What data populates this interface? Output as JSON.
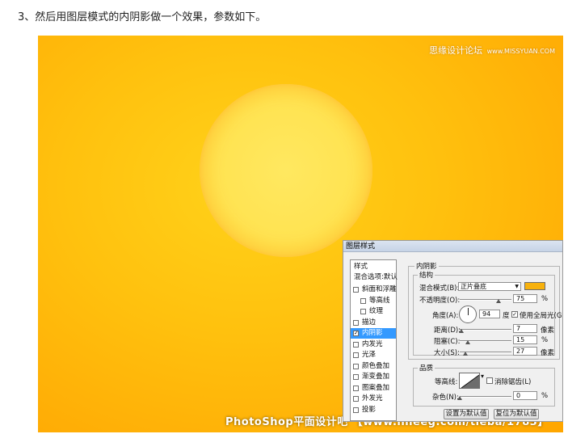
{
  "caption": "3、然后用图层模式的内阴影做一个效果，参数如下。",
  "watermarks": {
    "site_name": "思缘设计论坛",
    "site_url": "www.MISSYUAN.COM",
    "bottom_text": "PhotoShop平面设计吧 【www.lineeg.com/tieba/1783】"
  },
  "colors": {
    "canvas_center": "#ffd21a",
    "canvas_edge": "#ffa600",
    "sun": "#ffe352",
    "shadow_color": "#f7b10c",
    "selection": "#3399ff"
  },
  "dialog": {
    "title": "图层样式",
    "styles_header": "样式",
    "blend_default": "混合选项:默认",
    "items": [
      {
        "label": "斜面和浮雕",
        "checked": false,
        "indent": false,
        "selected": false
      },
      {
        "label": "等高线",
        "checked": false,
        "indent": true,
        "selected": false
      },
      {
        "label": "纹理",
        "checked": false,
        "indent": true,
        "selected": false
      },
      {
        "label": "描边",
        "checked": false,
        "indent": false,
        "selected": false
      },
      {
        "label": "内阴影",
        "checked": true,
        "indent": false,
        "selected": true
      },
      {
        "label": "内发光",
        "checked": false,
        "indent": false,
        "selected": false
      },
      {
        "label": "光泽",
        "checked": false,
        "indent": false,
        "selected": false
      },
      {
        "label": "颜色叠加",
        "checked": false,
        "indent": false,
        "selected": false
      },
      {
        "label": "渐变叠加",
        "checked": false,
        "indent": false,
        "selected": false
      },
      {
        "label": "图案叠加",
        "checked": false,
        "indent": false,
        "selected": false
      },
      {
        "label": "外发光",
        "checked": false,
        "indent": false,
        "selected": false
      },
      {
        "label": "投影",
        "checked": false,
        "indent": false,
        "selected": false
      }
    ],
    "inner_shadow": {
      "title": "内阴影",
      "structure": "结构",
      "blend_mode_label": "混合模式(B):",
      "blend_mode_value": "正片叠底",
      "opacity_label": "不透明度(O):",
      "opacity_value": "75",
      "opacity_fraction": 0.75,
      "percent": "%",
      "angle_label": "角度(A):",
      "angle_value": "94",
      "degree": "度",
      "global_light_label": "使用全局光(G)",
      "global_light_checked": true,
      "distance_label": "距离(D):",
      "distance_value": "7",
      "distance_fraction": 0.03,
      "choke_label": "阻塞(C):",
      "choke_value": "15",
      "choke_fraction": 0.15,
      "size_label": "大小(S):",
      "size_value": "27",
      "size_fraction": 0.11,
      "pixel_unit": "像素",
      "quality": "品质",
      "contour_label": "等高线:",
      "anti_alias_label": "消除锯齿(L)",
      "anti_alias_checked": false,
      "noise_label": "杂色(N):",
      "noise_value": "0",
      "noise_fraction": 0,
      "set_default_button": "设置为默认值",
      "reset_default_button": "复位为默认值"
    }
  }
}
